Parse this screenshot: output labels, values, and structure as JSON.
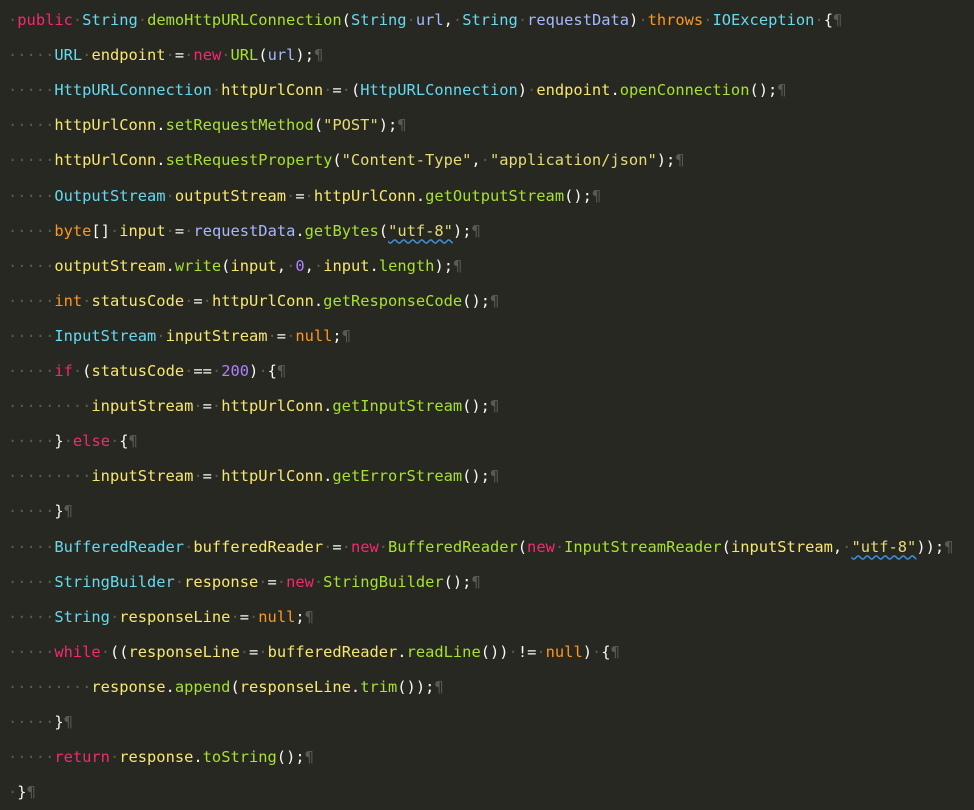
{
  "editor": {
    "colors": {
      "background": "#272822",
      "plain": "#F8F8F2",
      "keyword": "#F92672",
      "storage_keyword": "#FD971F",
      "type": "#66D9EF",
      "identifier": "#A6E22E",
      "method": "#A6E22E",
      "string": "#E6DB74",
      "number": "#AE81FF",
      "whitespace_marker": "#5a5a4f",
      "spellcheck_underline": "#3f8fd8"
    },
    "whitespace_glyph": "·",
    "eol_glyph": "¶",
    "lines": [
      {
        "indent": 0,
        "tokens": [
          {
            "t": "public",
            "c": "keyword"
          },
          {
            "t": " ",
            "c": "ws"
          },
          {
            "t": "String",
            "c": "type"
          },
          {
            "t": " ",
            "c": "ws"
          },
          {
            "t": "demoHttpURLConnection",
            "c": "identifier"
          },
          {
            "t": "(",
            "c": "plain"
          },
          {
            "t": "String",
            "c": "type"
          },
          {
            "t": " ",
            "c": "ws"
          },
          {
            "t": "url",
            "c": "param"
          },
          {
            "t": ",",
            "c": "plain"
          },
          {
            "t": " ",
            "c": "ws"
          },
          {
            "t": "String",
            "c": "type"
          },
          {
            "t": " ",
            "c": "ws"
          },
          {
            "t": "requestData",
            "c": "param"
          },
          {
            "t": ")",
            "c": "plain"
          },
          {
            "t": " ",
            "c": "ws"
          },
          {
            "t": "throws",
            "c": "storage_keyword"
          },
          {
            "t": " ",
            "c": "ws"
          },
          {
            "t": "IOException",
            "c": "type"
          },
          {
            "t": " ",
            "c": "ws"
          },
          {
            "t": "{",
            "c": "plain"
          }
        ]
      },
      {
        "indent": 4,
        "tokens": [
          {
            "t": "URL",
            "c": "type"
          },
          {
            "t": " ",
            "c": "ws"
          },
          {
            "t": "endpoint",
            "c": "var"
          },
          {
            "t": " ",
            "c": "ws"
          },
          {
            "t": "=",
            "c": "plain"
          },
          {
            "t": " ",
            "c": "ws"
          },
          {
            "t": "new",
            "c": "keyword"
          },
          {
            "t": " ",
            "c": "ws"
          },
          {
            "t": "URL",
            "c": "identifier"
          },
          {
            "t": "(",
            "c": "plain"
          },
          {
            "t": "url",
            "c": "param"
          },
          {
            "t": ");",
            "c": "plain"
          }
        ]
      },
      {
        "indent": 4,
        "tokens": [
          {
            "t": "HttpURLConnection",
            "c": "type"
          },
          {
            "t": " ",
            "c": "ws"
          },
          {
            "t": "httpUrlConn",
            "c": "var"
          },
          {
            "t": " ",
            "c": "ws"
          },
          {
            "t": "=",
            "c": "plain"
          },
          {
            "t": " ",
            "c": "ws"
          },
          {
            "t": "(",
            "c": "plain"
          },
          {
            "t": "HttpURLConnection",
            "c": "type"
          },
          {
            "t": ")",
            "c": "plain"
          },
          {
            "t": " ",
            "c": "ws"
          },
          {
            "t": "endpoint",
            "c": "var"
          },
          {
            "t": ".",
            "c": "plain"
          },
          {
            "t": "openConnection",
            "c": "method"
          },
          {
            "t": "();",
            "c": "plain"
          }
        ]
      },
      {
        "indent": 4,
        "tokens": [
          {
            "t": "httpUrlConn",
            "c": "var"
          },
          {
            "t": ".",
            "c": "plain"
          },
          {
            "t": "setRequestMethod",
            "c": "method"
          },
          {
            "t": "(",
            "c": "plain"
          },
          {
            "t": "\"POST\"",
            "c": "string"
          },
          {
            "t": ");",
            "c": "plain"
          }
        ]
      },
      {
        "indent": 4,
        "tokens": [
          {
            "t": "httpUrlConn",
            "c": "var"
          },
          {
            "t": ".",
            "c": "plain"
          },
          {
            "t": "setRequestProperty",
            "c": "method"
          },
          {
            "t": "(",
            "c": "plain"
          },
          {
            "t": "\"Content-Type\"",
            "c": "string"
          },
          {
            "t": ",",
            "c": "plain"
          },
          {
            "t": " ",
            "c": "ws"
          },
          {
            "t": "\"application/json\"",
            "c": "string"
          },
          {
            "t": ");",
            "c": "plain"
          }
        ]
      },
      {
        "indent": 4,
        "tokens": [
          {
            "t": "OutputStream",
            "c": "type"
          },
          {
            "t": " ",
            "c": "ws"
          },
          {
            "t": "outputStream",
            "c": "var"
          },
          {
            "t": " ",
            "c": "ws"
          },
          {
            "t": "=",
            "c": "plain"
          },
          {
            "t": " ",
            "c": "ws"
          },
          {
            "t": "httpUrlConn",
            "c": "var"
          },
          {
            "t": ".",
            "c": "plain"
          },
          {
            "t": "getOutputStream",
            "c": "method"
          },
          {
            "t": "();",
            "c": "plain"
          }
        ]
      },
      {
        "indent": 4,
        "tokens": [
          {
            "t": "byte",
            "c": "storage_keyword"
          },
          {
            "t": "[]",
            "c": "plain"
          },
          {
            "t": " ",
            "c": "ws"
          },
          {
            "t": "input",
            "c": "var"
          },
          {
            "t": " ",
            "c": "ws"
          },
          {
            "t": "=",
            "c": "plain"
          },
          {
            "t": " ",
            "c": "ws"
          },
          {
            "t": "requestData",
            "c": "param"
          },
          {
            "t": ".",
            "c": "plain"
          },
          {
            "t": "getBytes",
            "c": "method"
          },
          {
            "t": "(",
            "c": "plain"
          },
          {
            "t": "\"utf-8\"",
            "c": "string",
            "squiggle": true
          },
          {
            "t": ");",
            "c": "plain"
          }
        ]
      },
      {
        "indent": 4,
        "tokens": [
          {
            "t": "outputStream",
            "c": "var"
          },
          {
            "t": ".",
            "c": "plain"
          },
          {
            "t": "write",
            "c": "method"
          },
          {
            "t": "(",
            "c": "plain"
          },
          {
            "t": "input",
            "c": "var"
          },
          {
            "t": ",",
            "c": "plain"
          },
          {
            "t": " ",
            "c": "ws"
          },
          {
            "t": "0",
            "c": "number"
          },
          {
            "t": ",",
            "c": "plain"
          },
          {
            "t": " ",
            "c": "ws"
          },
          {
            "t": "input",
            "c": "var"
          },
          {
            "t": ".",
            "c": "plain"
          },
          {
            "t": "length",
            "c": "method"
          },
          {
            "t": ");",
            "c": "plain"
          }
        ]
      },
      {
        "indent": 4,
        "tokens": [
          {
            "t": "int",
            "c": "storage_keyword"
          },
          {
            "t": " ",
            "c": "ws"
          },
          {
            "t": "statusCode",
            "c": "var"
          },
          {
            "t": " ",
            "c": "ws"
          },
          {
            "t": "=",
            "c": "plain"
          },
          {
            "t": " ",
            "c": "ws"
          },
          {
            "t": "httpUrlConn",
            "c": "var"
          },
          {
            "t": ".",
            "c": "plain"
          },
          {
            "t": "getResponseCode",
            "c": "method"
          },
          {
            "t": "();",
            "c": "plain"
          }
        ]
      },
      {
        "indent": 4,
        "tokens": [
          {
            "t": "InputStream",
            "c": "type"
          },
          {
            "t": " ",
            "c": "ws"
          },
          {
            "t": "inputStream",
            "c": "var"
          },
          {
            "t": " ",
            "c": "ws"
          },
          {
            "t": "=",
            "c": "plain"
          },
          {
            "t": " ",
            "c": "ws"
          },
          {
            "t": "null",
            "c": "constant"
          },
          {
            "t": ";",
            "c": "plain"
          }
        ]
      },
      {
        "indent": 4,
        "tokens": [
          {
            "t": "if",
            "c": "keyword"
          },
          {
            "t": " ",
            "c": "ws"
          },
          {
            "t": "(",
            "c": "plain"
          },
          {
            "t": "statusCode",
            "c": "var"
          },
          {
            "t": " ",
            "c": "ws"
          },
          {
            "t": "==",
            "c": "plain"
          },
          {
            "t": " ",
            "c": "ws"
          },
          {
            "t": "200",
            "c": "number"
          },
          {
            "t": ")",
            "c": "plain"
          },
          {
            "t": " ",
            "c": "ws"
          },
          {
            "t": "{",
            "c": "plain"
          }
        ]
      },
      {
        "indent": 8,
        "tokens": [
          {
            "t": "inputStream",
            "c": "var"
          },
          {
            "t": " ",
            "c": "ws"
          },
          {
            "t": "=",
            "c": "plain"
          },
          {
            "t": " ",
            "c": "ws"
          },
          {
            "t": "httpUrlConn",
            "c": "var"
          },
          {
            "t": ".",
            "c": "plain"
          },
          {
            "t": "getInputStream",
            "c": "method"
          },
          {
            "t": "();",
            "c": "plain"
          }
        ]
      },
      {
        "indent": 4,
        "tokens": [
          {
            "t": "}",
            "c": "plain"
          },
          {
            "t": " ",
            "c": "ws"
          },
          {
            "t": "else",
            "c": "keyword"
          },
          {
            "t": " ",
            "c": "ws"
          },
          {
            "t": "{",
            "c": "plain"
          }
        ]
      },
      {
        "indent": 8,
        "tokens": [
          {
            "t": "inputStream",
            "c": "var"
          },
          {
            "t": " ",
            "c": "ws"
          },
          {
            "t": "=",
            "c": "plain"
          },
          {
            "t": " ",
            "c": "ws"
          },
          {
            "t": "httpUrlConn",
            "c": "var"
          },
          {
            "t": ".",
            "c": "plain"
          },
          {
            "t": "getErrorStream",
            "c": "method"
          },
          {
            "t": "();",
            "c": "plain"
          }
        ]
      },
      {
        "indent": 4,
        "tokens": [
          {
            "t": "}",
            "c": "plain"
          }
        ]
      },
      {
        "indent": 4,
        "tokens": [
          {
            "t": "BufferedReader",
            "c": "type"
          },
          {
            "t": " ",
            "c": "ws"
          },
          {
            "t": "bufferedReader",
            "c": "var"
          },
          {
            "t": " ",
            "c": "ws"
          },
          {
            "t": "=",
            "c": "plain"
          },
          {
            "t": " ",
            "c": "ws"
          },
          {
            "t": "new",
            "c": "keyword"
          },
          {
            "t": " ",
            "c": "ws"
          },
          {
            "t": "BufferedReader",
            "c": "identifier"
          },
          {
            "t": "(",
            "c": "plain"
          },
          {
            "t": "new",
            "c": "keyword"
          },
          {
            "t": " ",
            "c": "ws"
          },
          {
            "t": "InputStreamReader",
            "c": "identifier"
          },
          {
            "t": "(",
            "c": "plain"
          },
          {
            "t": "inputStream",
            "c": "var"
          },
          {
            "t": ",",
            "c": "plain"
          },
          {
            "t": " ",
            "c": "ws"
          },
          {
            "t": "\"utf-8\"",
            "c": "string",
            "squiggle": true
          },
          {
            "t": "));",
            "c": "plain"
          }
        ]
      },
      {
        "indent": 4,
        "tokens": [
          {
            "t": "StringBuilder",
            "c": "type"
          },
          {
            "t": " ",
            "c": "ws"
          },
          {
            "t": "response",
            "c": "var"
          },
          {
            "t": " ",
            "c": "ws"
          },
          {
            "t": "=",
            "c": "plain"
          },
          {
            "t": " ",
            "c": "ws"
          },
          {
            "t": "new",
            "c": "keyword"
          },
          {
            "t": " ",
            "c": "ws"
          },
          {
            "t": "StringBuilder",
            "c": "identifier"
          },
          {
            "t": "();",
            "c": "plain"
          }
        ]
      },
      {
        "indent": 4,
        "tokens": [
          {
            "t": "String",
            "c": "type"
          },
          {
            "t": " ",
            "c": "ws"
          },
          {
            "t": "responseLine",
            "c": "var"
          },
          {
            "t": " ",
            "c": "ws"
          },
          {
            "t": "=",
            "c": "plain"
          },
          {
            "t": " ",
            "c": "ws"
          },
          {
            "t": "null",
            "c": "constant"
          },
          {
            "t": ";",
            "c": "plain"
          }
        ]
      },
      {
        "indent": 4,
        "tokens": [
          {
            "t": "while",
            "c": "keyword"
          },
          {
            "t": " ",
            "c": "ws"
          },
          {
            "t": "((",
            "c": "plain"
          },
          {
            "t": "responseLine",
            "c": "var"
          },
          {
            "t": " ",
            "c": "ws"
          },
          {
            "t": "=",
            "c": "plain"
          },
          {
            "t": " ",
            "c": "ws"
          },
          {
            "t": "bufferedReader",
            "c": "var"
          },
          {
            "t": ".",
            "c": "plain"
          },
          {
            "t": "readLine",
            "c": "method"
          },
          {
            "t": "())",
            "c": "plain"
          },
          {
            "t": " ",
            "c": "ws"
          },
          {
            "t": "!=",
            "c": "plain"
          },
          {
            "t": " ",
            "c": "ws"
          },
          {
            "t": "null",
            "c": "constant"
          },
          {
            "t": ")",
            "c": "plain"
          },
          {
            "t": " ",
            "c": "ws"
          },
          {
            "t": "{",
            "c": "plain"
          }
        ]
      },
      {
        "indent": 8,
        "tokens": [
          {
            "t": "response",
            "c": "var"
          },
          {
            "t": ".",
            "c": "plain"
          },
          {
            "t": "append",
            "c": "method"
          },
          {
            "t": "(",
            "c": "plain"
          },
          {
            "t": "responseLine",
            "c": "var"
          },
          {
            "t": ".",
            "c": "plain"
          },
          {
            "t": "trim",
            "c": "method"
          },
          {
            "t": "());",
            "c": "plain"
          }
        ]
      },
      {
        "indent": 4,
        "tokens": [
          {
            "t": "}",
            "c": "plain"
          }
        ]
      },
      {
        "indent": 4,
        "tokens": [
          {
            "t": "return",
            "c": "keyword"
          },
          {
            "t": " ",
            "c": "ws"
          },
          {
            "t": "response",
            "c": "var"
          },
          {
            "t": ".",
            "c": "plain"
          },
          {
            "t": "toString",
            "c": "method"
          },
          {
            "t": "();",
            "c": "plain"
          }
        ]
      },
      {
        "indent": 0,
        "tokens": [
          {
            "t": "}",
            "c": "plain"
          }
        ]
      }
    ]
  }
}
